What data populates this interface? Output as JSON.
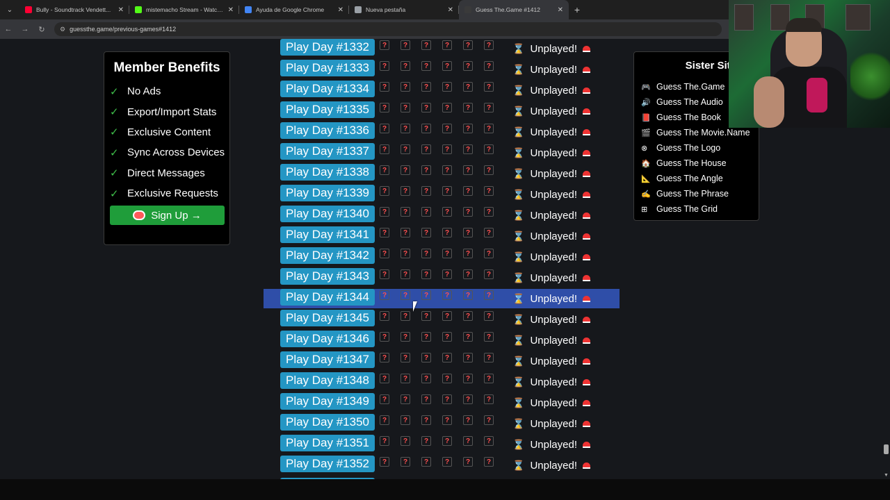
{
  "tabs": [
    {
      "title": "Bully - Soundtrack Vendett...",
      "icon": "youtube-icon",
      "color": "#ff0033",
      "active": false
    },
    {
      "title": "mistemacho Stream - Watch Li...",
      "icon": "kick-icon",
      "color": "#53fc18",
      "active": false
    },
    {
      "title": "Ayuda de Google Chrome",
      "icon": "google-icon",
      "color": "#4285f4",
      "active": false
    },
    {
      "title": "Nueva pestaña",
      "icon": "chrome-icon",
      "color": "#9aa0a6",
      "active": false
    },
    {
      "title": "Guess The.Game #1412",
      "icon": "guessthegame-icon",
      "color": "#3a3a3a",
      "active": true
    }
  ],
  "url": "guessthe.game/previous-games#1412",
  "benefits": {
    "title": "Member Benefits",
    "items": [
      "No Ads",
      "Export/Import Stats",
      "Exclusive Content",
      "Sync Across Devices",
      "Direct Messages",
      "Exclusive Requests"
    ],
    "check": "✓",
    "signup_label": "Sign Up →"
  },
  "sister": {
    "title": "Sister Sites",
    "items": [
      {
        "label": "Guess The.Game",
        "icon": "🎮"
      },
      {
        "label": "Guess The Audio",
        "icon": "🔊"
      },
      {
        "label": "Guess The Book",
        "icon": "📕"
      },
      {
        "label": "Guess The Movie.Name",
        "icon": "🎬"
      },
      {
        "label": "Guess The Logo",
        "icon": "⊗"
      },
      {
        "label": "Guess The House",
        "icon": "🏠"
      },
      {
        "label": "Guess The Angle",
        "icon": "📐"
      },
      {
        "label": "Guess The Phrase",
        "icon": "✍"
      },
      {
        "label": "Guess The Grid",
        "icon": "⊞"
      }
    ]
  },
  "games": [
    {
      "label": "Play Day #1332",
      "status": "Unplayed!"
    },
    {
      "label": "Play Day #1333",
      "status": "Unplayed!"
    },
    {
      "label": "Play Day #1334",
      "status": "Unplayed!"
    },
    {
      "label": "Play Day #1335",
      "status": "Unplayed!"
    },
    {
      "label": "Play Day #1336",
      "status": "Unplayed!"
    },
    {
      "label": "Play Day #1337",
      "status": "Unplayed!"
    },
    {
      "label": "Play Day #1338",
      "status": "Unplayed!"
    },
    {
      "label": "Play Day #1339",
      "status": "Unplayed!"
    },
    {
      "label": "Play Day #1340",
      "status": "Unplayed!"
    },
    {
      "label": "Play Day #1341",
      "status": "Unplayed!"
    },
    {
      "label": "Play Day #1342",
      "status": "Unplayed!"
    },
    {
      "label": "Play Day #1343",
      "status": "Unplayed!"
    },
    {
      "label": "Play Day #1344",
      "status": "Unplayed!",
      "highlighted": true
    },
    {
      "label": "Play Day #1345",
      "status": "Unplayed!"
    },
    {
      "label": "Play Day #1346",
      "status": "Unplayed!"
    },
    {
      "label": "Play Day #1347",
      "status": "Unplayed!"
    },
    {
      "label": "Play Day #1348",
      "status": "Unplayed!"
    },
    {
      "label": "Play Day #1349",
      "status": "Unplayed!"
    },
    {
      "label": "Play Day #1350",
      "status": "Unplayed!"
    },
    {
      "label": "Play Day #1351",
      "status": "Unplayed!"
    },
    {
      "label": "Play Day #1352",
      "status": "Unplayed!"
    }
  ],
  "guess_mark": "?",
  "hourglass": "⌛",
  "colors": {
    "play_button": "#2496c4",
    "highlight_row": "#2f4ea8",
    "signup": "#1f9d3a",
    "check": "#3fbf4a",
    "guess_mark": "#ff4f4f"
  }
}
